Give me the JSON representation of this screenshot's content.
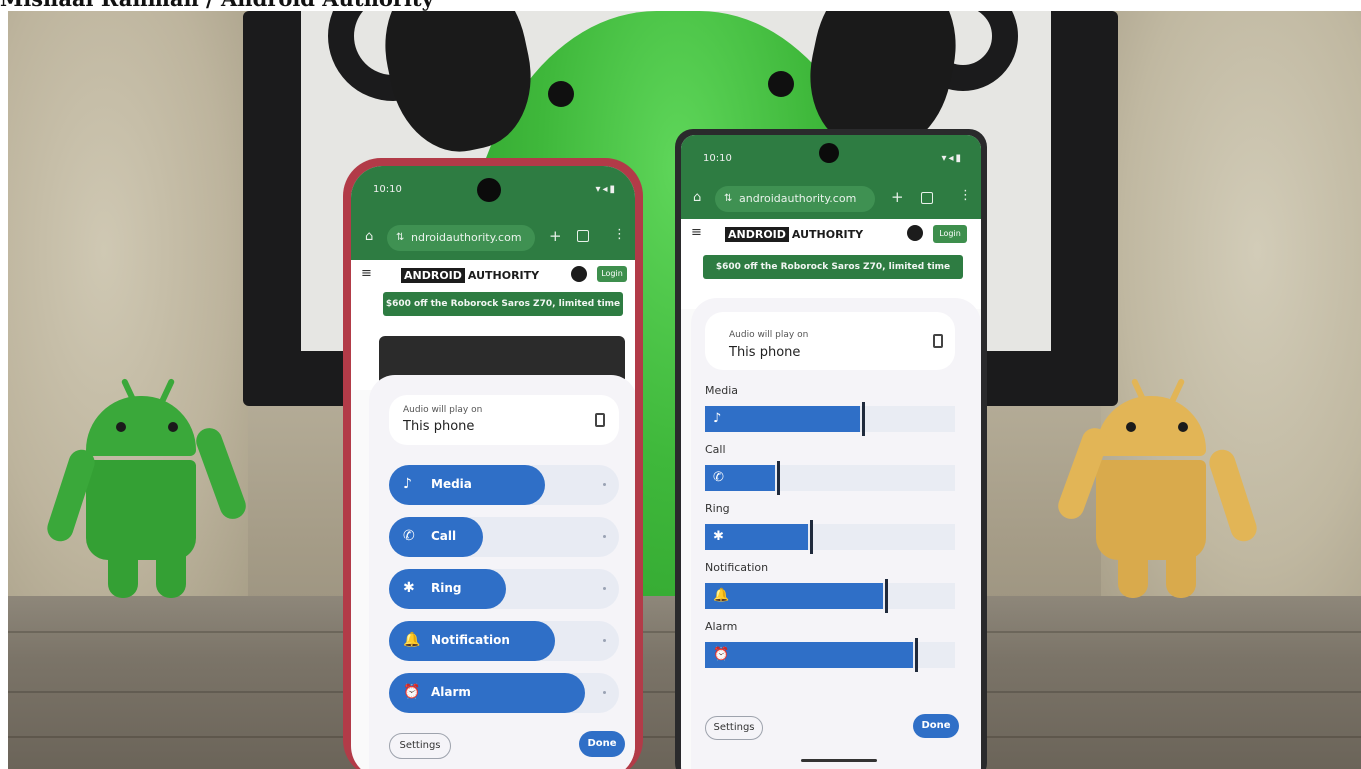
{
  "caption": "Mishaal Rahman / Android Authority",
  "colors": {
    "accent_blue": "#2f6fc7",
    "browser_green": "#2e7c42",
    "plush_green": "#3fb83b",
    "android_green": "#3aa83a",
    "wood_android": "#e2b556"
  },
  "left_phone": {
    "status_time": "10:10",
    "status_icons": "▾◂▮",
    "url": "ndroidauthority.com",
    "logo_box": "ANDROID",
    "logo_text": "AUTHORITY",
    "login_label": "Login",
    "promo": "$600 off the Roborock Saros Z70, limited time",
    "output_label": "Audio will play on",
    "output_value": "This phone",
    "sliders": [
      {
        "label": "Media",
        "icon": "♪",
        "level": 0.68
      },
      {
        "label": "Call",
        "icon": "✆",
        "level": 0.41
      },
      {
        "label": "Ring",
        "icon": "✱",
        "level": 0.51
      },
      {
        "label": "Notification",
        "icon": "🔔",
        "level": 0.72
      },
      {
        "label": "Alarm",
        "icon": "⏰",
        "level": 0.85
      }
    ],
    "settings_label": "Settings",
    "done_label": "Done"
  },
  "right_phone": {
    "status_time": "10:10",
    "status_icons": "▾◂▮",
    "url": "androidauthority.com",
    "logo_box": "ANDROID",
    "logo_text": "AUTHORITY",
    "login_label": "Login",
    "promo": "$600 off the Roborock Saros Z70, limited time",
    "output_label": "Audio will play on",
    "output_value": "This phone",
    "sliders": [
      {
        "label": "Media",
        "icon": "♪",
        "level": 0.62
      },
      {
        "label": "Call",
        "icon": "✆",
        "level": 0.28
      },
      {
        "label": "Ring",
        "icon": "✱",
        "level": 0.41
      },
      {
        "label": "Notification",
        "icon": "🔔",
        "level": 0.71
      },
      {
        "label": "Alarm",
        "icon": "⏰",
        "level": 0.83
      }
    ],
    "settings_label": "Settings",
    "done_label": "Done"
  }
}
